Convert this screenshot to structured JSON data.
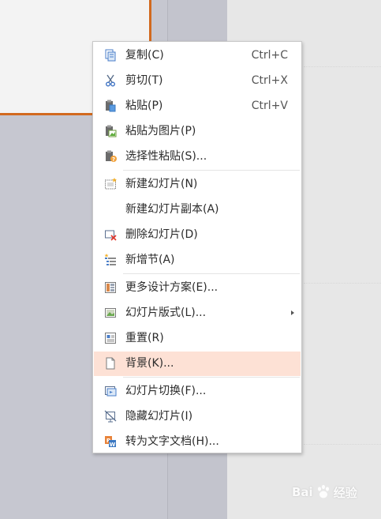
{
  "menu": {
    "items": [
      {
        "label": "复制(C)",
        "shortcut": "Ctrl+C",
        "icon": "copy-icon"
      },
      {
        "label": "剪切(T)",
        "shortcut": "Ctrl+X",
        "icon": "scissors-icon"
      },
      {
        "label": "粘贴(P)",
        "shortcut": "Ctrl+V",
        "icon": "paste-icon"
      },
      {
        "label": "粘贴为图片(P)",
        "icon": "paste-as-image-icon"
      },
      {
        "label": "选择性粘贴(S)...",
        "icon": "paste-special-icon"
      },
      {
        "label": "新建幻灯片(N)",
        "icon": "new-slide-icon"
      },
      {
        "label": "新建幻灯片副本(A)"
      },
      {
        "label": "删除幻灯片(D)",
        "icon": "delete-slide-icon"
      },
      {
        "label": "新增节(A)",
        "icon": "new-section-icon"
      },
      {
        "label": "更多设计方案(E)...",
        "icon": "design-scheme-icon"
      },
      {
        "label": "幻灯片版式(L)...",
        "icon": "slide-layout-icon",
        "submenu": true
      },
      {
        "label": "重置(R)",
        "icon": "reset-icon"
      },
      {
        "label": "背景(K)...",
        "icon": "background-icon",
        "highlighted": true
      },
      {
        "label": "幻灯片切换(F)...",
        "icon": "slide-transition-icon"
      },
      {
        "label": "隐藏幻灯片(I)",
        "icon": "hide-slide-icon"
      },
      {
        "label": "转为文字文档(H)...",
        "icon": "convert-to-doc-icon"
      }
    ]
  },
  "watermark": {
    "brand": "Bai",
    "suffix": "经验"
  },
  "colors": {
    "highlight": "#fde1d5",
    "accent_orange": "#d2691e",
    "menu_bg": "#ffffff"
  }
}
